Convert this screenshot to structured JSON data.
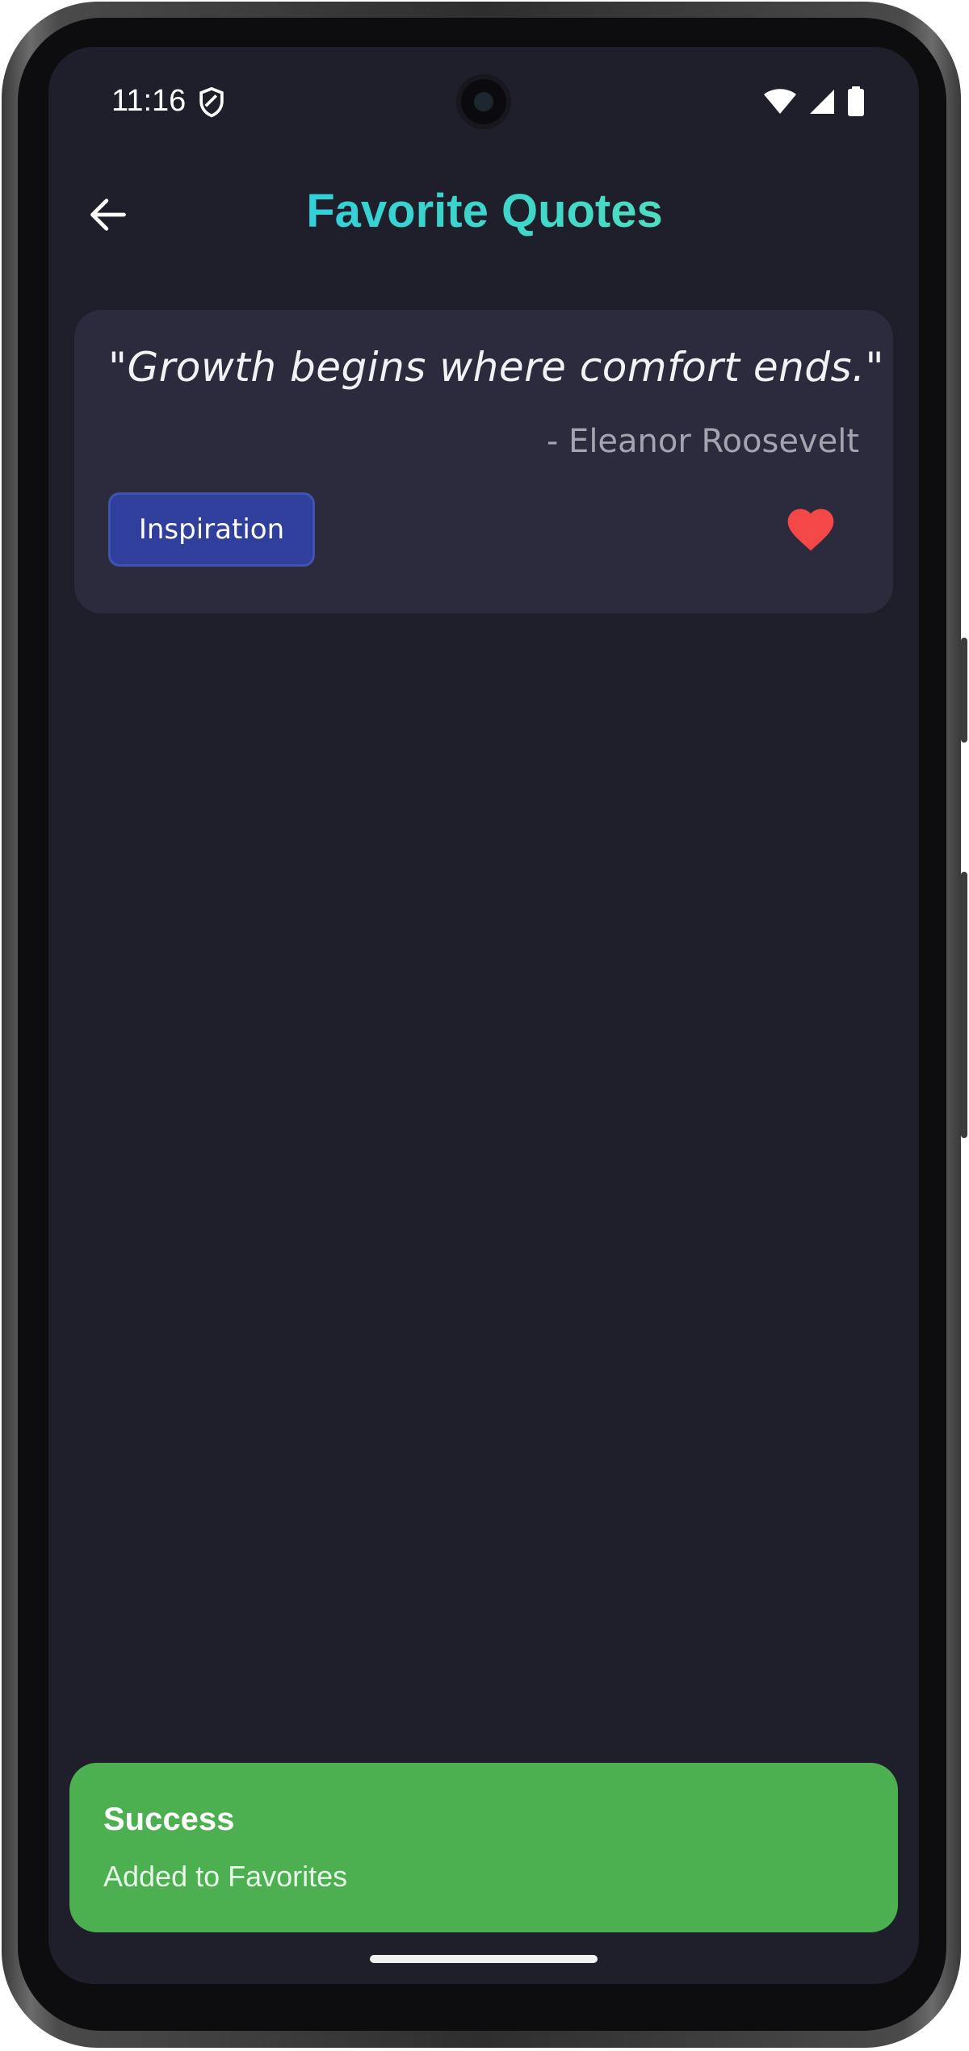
{
  "status_bar": {
    "time": "11:16",
    "icons": [
      "shield-icon",
      "wifi-icon",
      "signal-icon",
      "battery-icon"
    ]
  },
  "header": {
    "back_icon": "arrow-left-icon",
    "title": "Favorite Quotes",
    "title_gradient": [
      "#1ec8f0",
      "#6fecb0"
    ]
  },
  "quotes": [
    {
      "text": "\"Growth begins where comfort ends.\"",
      "author": "- Eleanor Roosevelt",
      "category": "Inspiration",
      "favorited": true,
      "favorite_icon": "heart-filled-icon"
    }
  ],
  "toast": {
    "title": "Success",
    "message": "Added to Favorites",
    "color": "#4caf50"
  },
  "colors": {
    "background": "#1f1f2c",
    "card": "#2b2b3d",
    "chip": "#303e9c",
    "heart": "#f44747"
  }
}
